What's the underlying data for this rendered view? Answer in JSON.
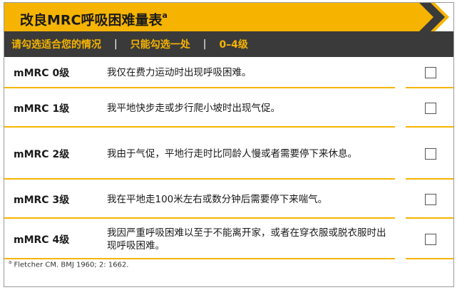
{
  "title": {
    "main": "改良MRC呼吸困难量表",
    "sup": "a"
  },
  "subtitle": {
    "left": "请勾选适合您的情况",
    "sep": "|",
    "middle": "只能勾选一处",
    "right": "0–4级"
  },
  "rows": [
    {
      "level": "mMRC 0级",
      "desc": "我仅在费力运动时出现呼吸困难。",
      "checked": false
    },
    {
      "level": "mMRC 1级",
      "desc": "我平地快步走或步行爬小坡时出现气促。",
      "checked": false
    },
    {
      "level": "mMRC 2级",
      "desc": "我由于气促，平地行走时比同龄人慢或者需要停下来休息。",
      "checked": false
    },
    {
      "level": "mMRC 3级",
      "desc": "我在平地走100米左右或数分钟后需要停下来喘气。",
      "checked": false
    },
    {
      "level": "mMRC 4级",
      "desc": "我因严重呼吸困难以至于不能离开家，或者在穿衣服或脱衣服时出现呼吸困难。",
      "checked": false
    }
  ],
  "footnote": {
    "sup": "a",
    "text": "Fletcher CM. BMJ 1960; 2: 1662."
  },
  "colors": {
    "accent": "#f6b400",
    "dark_bar": "#3a3a3a"
  }
}
